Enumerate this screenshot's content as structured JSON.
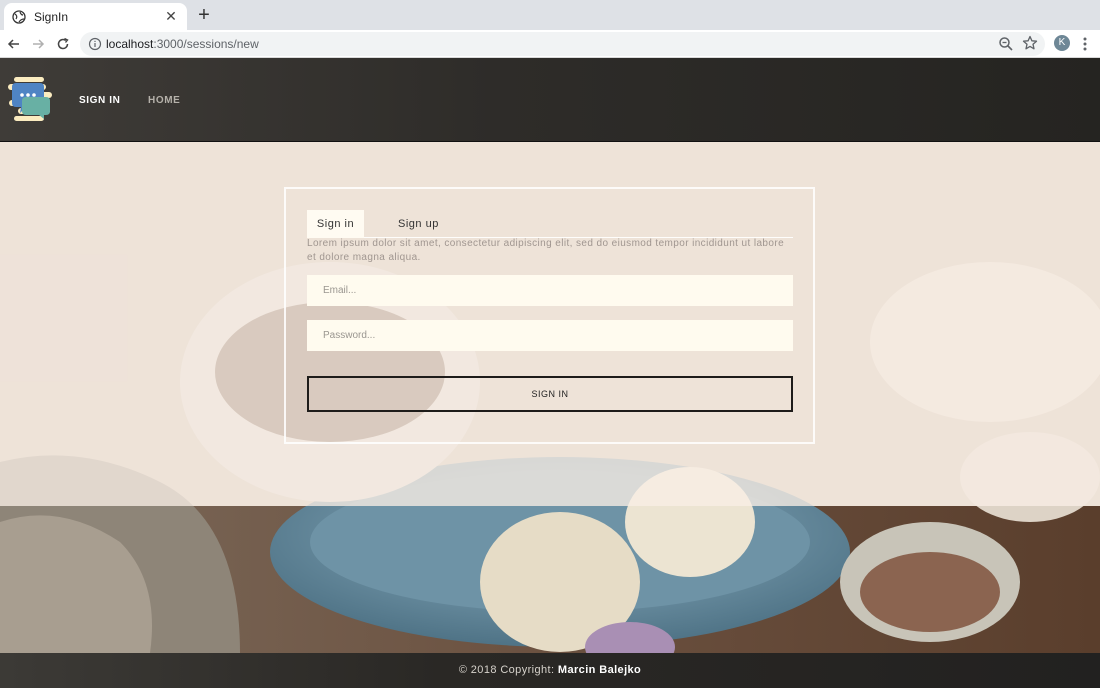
{
  "browser": {
    "tab_title": "SignIn",
    "url_host": "localhost",
    "url_path": ":3000/sessions/new",
    "profile_initial": "K"
  },
  "header": {
    "nav": {
      "signin": "SIGN IN",
      "home": "HOME"
    }
  },
  "form": {
    "tab_signin": "Sign in",
    "tab_signup": "Sign up",
    "description": "Lorem ipsum dolor sit amet, consectetur adipiscing elit, sed do eiusmod tempor incididunt ut labore et dolore magna aliqua.",
    "email_placeholder": "Email...",
    "password_placeholder": "Password...",
    "submit_label": "SIGN IN"
  },
  "footer": {
    "copyright": "© 2018 Copyright:",
    "author": "Marcin Balejko"
  },
  "colors": {
    "header_bg": "#2e2c29",
    "input_bg": "#fffbef",
    "veil": "#f8eee6"
  }
}
